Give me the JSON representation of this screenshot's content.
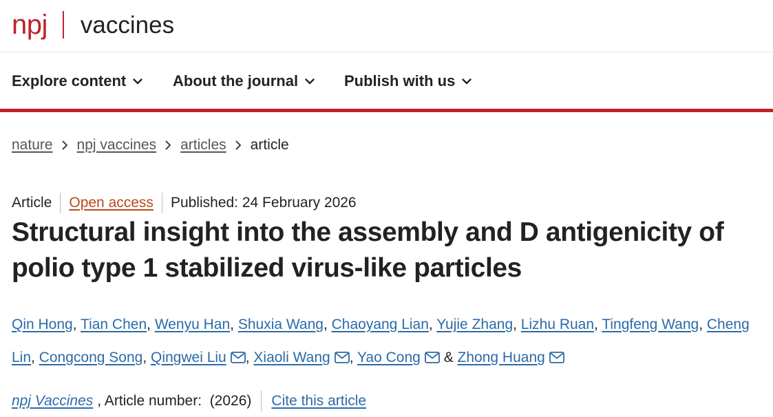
{
  "brand": {
    "logo_primary": "npj",
    "logo_journal": "vaccines",
    "accent_color": "#c0212b"
  },
  "nav": {
    "items": [
      {
        "label": "Explore content",
        "icon": "chevron-down-icon"
      },
      {
        "label": "About the journal",
        "icon": "chevron-down-icon"
      },
      {
        "label": "Publish with us",
        "icon": "chevron-down-icon"
      }
    ]
  },
  "breadcrumb": {
    "items": [
      {
        "label": "nature"
      },
      {
        "label": "npj vaccines"
      },
      {
        "label": "articles"
      },
      {
        "label": "article"
      }
    ],
    "separator_icon": "chevron-right-icon"
  },
  "article": {
    "type": "Article",
    "access": "Open access",
    "published": "Published: 24 February 2026",
    "title": "Structural insight into the assembly and D antigenicity of polio type 1 stabilized virus-like particles",
    "authors": [
      "Qin Hong",
      "Tian Chen",
      "Wenyu Han",
      "Shuxia Wang",
      "Chaoyang Lian",
      "Yujie Zhang",
      "Lizhu Ruan",
      "Tingfeng Wang",
      "Cheng Lin",
      "Congcong Song",
      "Qingwei Liu",
      "Xiaoli Wang",
      "Yao Cong",
      "Zhong Huang"
    ],
    "author_separator": ", ",
    "author_last_separator": "&",
    "corresponding_icon": "mail-icon",
    "citation": {
      "journal": "npj Vaccines",
      "article_number": ", Article number:  (2026)",
      "cite_label": "Cite this article"
    }
  },
  "colors": {
    "link": "#2b6aa8",
    "open_access": "#b94a1a",
    "text": "#222222"
  }
}
